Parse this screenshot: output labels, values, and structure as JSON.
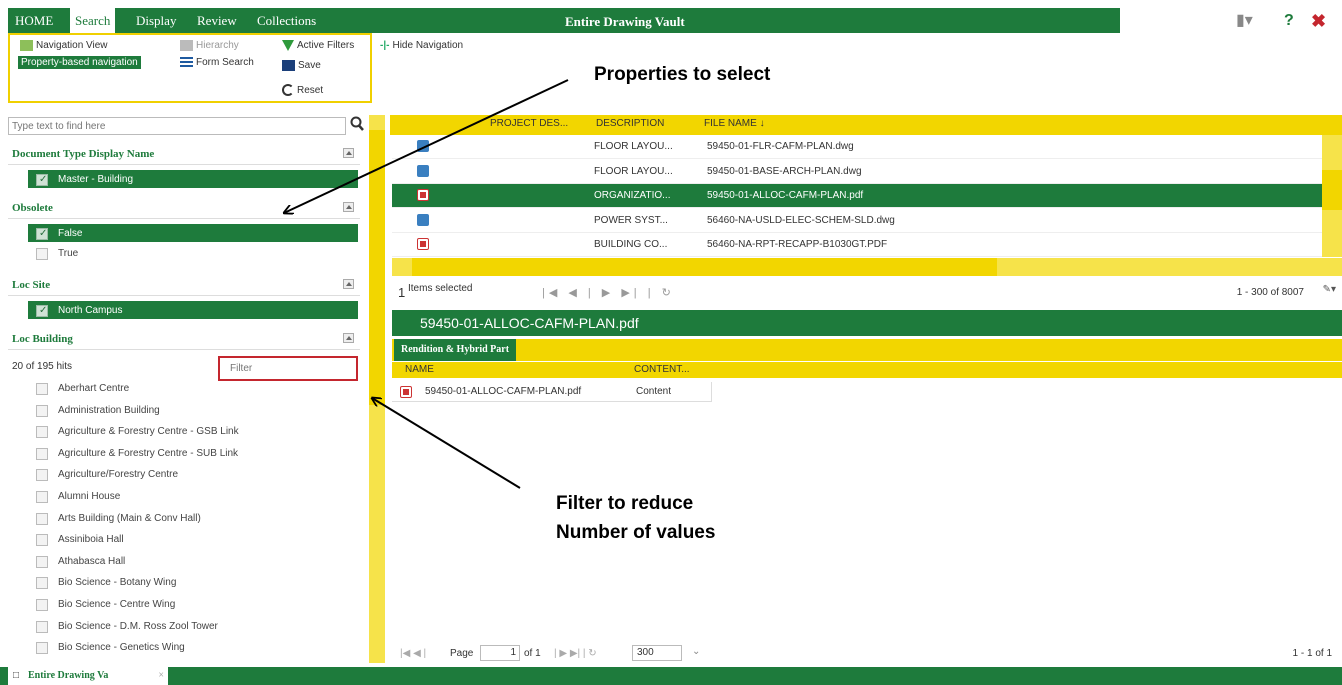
{
  "menu": {
    "tabs": [
      "HOME",
      "Search",
      "Display",
      "Review",
      "Collections"
    ],
    "active_tab": "Search",
    "title": "Entire Drawing Vault"
  },
  "ribbon": {
    "navigation_view": "Navigation View",
    "hierarchy": "Hierarchy",
    "active_filters": "Active Filters",
    "hide_navigation": "Hide Navigation",
    "property_nav": "Property-based navigation",
    "form_search": "Form Search",
    "save": "Save",
    "reset": "Reset"
  },
  "search": {
    "placeholder": "Type text to find here"
  },
  "sections": {
    "doc_type": {
      "title": "Document Type Display Name",
      "items": [
        "Master - Building"
      ]
    },
    "obsolete": {
      "title": "Obsolete",
      "items": [
        "False",
        "True"
      ]
    },
    "loc_site": {
      "title": "Loc Site",
      "items": [
        "North Campus"
      ]
    },
    "loc_building": {
      "title": "Loc Building",
      "hits": "20 of 195 hits",
      "filter_placeholder": "Filter",
      "items": [
        "Aberhart Centre",
        "Administration Building",
        "Agriculture & Forestry Centre - GSB Link",
        "Agriculture & Forestry Centre - SUB Link",
        "Agriculture/Forestry Centre",
        "Alumni House",
        "Arts Building (Main & Conv Hall)",
        "Assiniboia Hall",
        "Athabasca Hall",
        "Bio Science - Botany Wing",
        "Bio Science - Centre Wing",
        "Bio Science - D.M. Ross Zool Tower",
        "Bio Science - Genetics Wing"
      ]
    }
  },
  "grid": {
    "headers": [
      "PROJECT DES...",
      "DESCRIPTION",
      "FILE NAME ↓"
    ],
    "rows": [
      {
        "desc": "FLOOR LAYOU...",
        "file": "59450-01-FLR-CAFM-PLAN.dwg"
      },
      {
        "desc": "FLOOR LAYOU...",
        "file": "59450-01-BASE-ARCH-PLAN.dwg"
      },
      {
        "desc": "ORGANIZATIO...",
        "file": "59450-01-ALLOC-CAFM-PLAN.pdf"
      },
      {
        "desc": "POWER SYST...",
        "file": "56460-NA-USLD-ELEC-SCHEM-SLD.dwg"
      },
      {
        "desc": "BUILDING CO...",
        "file": "56460-NA-RPT-RECAPP-B1030GT.PDF"
      }
    ],
    "selected_count": "1",
    "selected_label": "Items selected",
    "range": "1 - 300 of 8007"
  },
  "preview": {
    "title": "59450-01-ALLOC-CAFM-PLAN.pdf",
    "tab": "Rendition & Hybrid Part",
    "headers": [
      "NAME",
      "CONTENT..."
    ],
    "row": {
      "name": "59450-01-ALLOC-CAFM-PLAN.pdf",
      "content": "Content"
    },
    "page_label": "Page",
    "page_value": "1",
    "of_label": "of 1",
    "page_size": "300",
    "range": "1 - 1 of 1"
  },
  "bottom": {
    "tab": "Entire Drawing Va"
  },
  "annotations": {
    "properties": "Properties to select",
    "filter_line1": "Filter to reduce",
    "filter_line2": "Number of values"
  },
  "colors": {
    "green": "#1e7b3c",
    "yellow": "#f2d600",
    "red": "#c4262e"
  }
}
